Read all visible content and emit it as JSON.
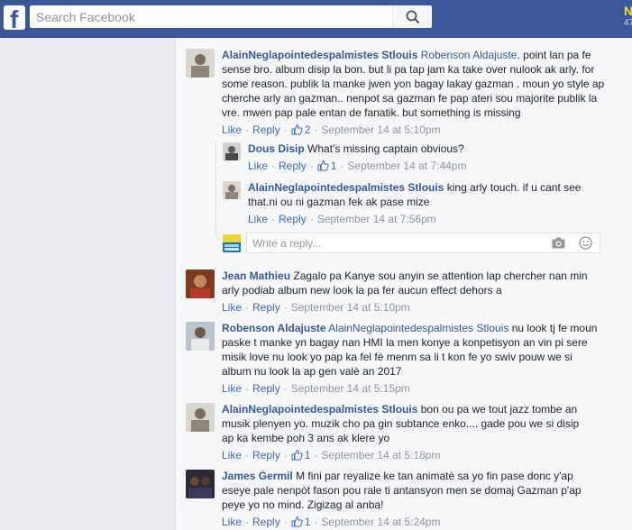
{
  "header": {
    "logo": "f",
    "search_placeholder": "Search Facebook",
    "edge_badge_top": "N",
    "edge_badge_bottom": "47"
  },
  "icons": {
    "logo": "facebook-f-icon",
    "search": "search-icon",
    "like": "thumbs-up-icon",
    "camera": "camera-icon",
    "emoji": "smiley-icon"
  },
  "comments": [
    {
      "author": "AlainNeglapointedespalmistes Stlouis",
      "mention": "Robenson Aldajuste",
      "text": ". point lan pa fe sense bro. album disip la bon. but li pa tap jam ka take over nulook ak arly. for some reason. publik la manke jwen yon bagay lakay gazman . moun yo style ap cherche arly an gazman.. nenpot sa gazman fe pap ateri sou majorite publik la vre. mwen pap pale entan de fanatik. but something is missing",
      "like": "Like",
      "reply": "Reply",
      "likes": "2",
      "time": "September 14 at 5:10pm",
      "replies": [
        {
          "author": "Dous Disip",
          "text": "What's missing captain obvious?",
          "like": "Like",
          "reply": "Reply",
          "likes": "1",
          "time": "September 14 at 7:44pm"
        },
        {
          "author": "AlainNeglapointedespalmistes Stlouis",
          "text": "king arly touch. if u cant see that.ni ou ni gazman fek ak pase mize",
          "like": "Like",
          "reply": "Reply",
          "time": "September 14 at 7:56pm"
        }
      ],
      "reply_placeholder": "Write a reply..."
    },
    {
      "author": "Jean Mathieu",
      "text": "Zagalo pa Kanye sou anyin se attention lap chercher nan min arly podiab album new look la pa fer aucun effect dehors a",
      "like": "Like",
      "reply": "Reply",
      "time": "September 14 at 5:10pm"
    },
    {
      "author": "Robenson Aldajuste",
      "mention": "AlainNeglapointedespalmistes Stlouis",
      "text": "nu look tj fe moun paske t manke yn bagay nan HMI la men konye a konpetisyon an vin pi sere misik love nu look yo pap ka fel fè menm sa li t kon fe yo swiv pouw we si album nu look la ap gen valè an 2017",
      "like": "Like",
      "reply": "Reply",
      "time": "September 14 at 5:15pm"
    },
    {
      "author": "AlainNeglapointedespalmistes Stlouis",
      "text": "bon ou pa we tout jazz tombe an musik plenyen yo. muzik cho pa gin subtance enko.... gade pou we si disip ap ka kembe poh 3 ans ak klere yo",
      "like": "Like",
      "reply": "Reply",
      "likes": "1",
      "time": "September 14 at 5:18pm"
    },
    {
      "author": "James Germil",
      "text": "M fini par reyalize ke tan animatè sa yo fin pase donc y'ap eseye pale nenpòt fason pou rale ti antansyon men se domaj Gazman p'ap peye yo no mind. Zigizag al anba!",
      "like": "Like",
      "reply": "Reply",
      "likes": "1",
      "time": "September 14 at 5:24pm"
    }
  ]
}
